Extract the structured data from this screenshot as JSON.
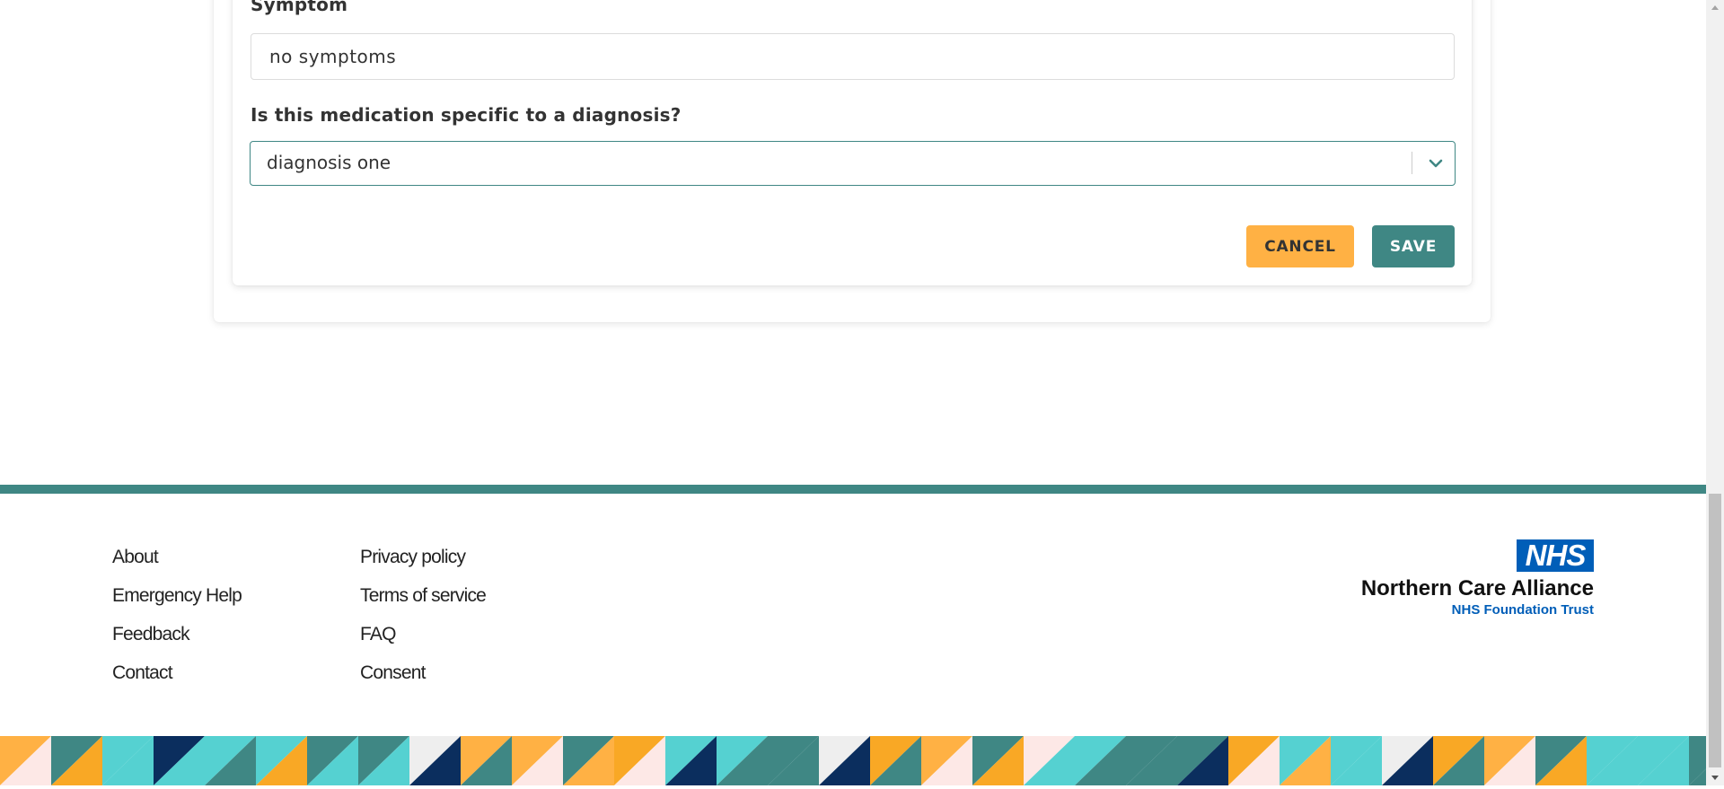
{
  "form": {
    "symptom_label": "Symptom",
    "symptom_value": "no symptoms",
    "diagnosis_question": "Is this medication specific to a diagnosis?",
    "diagnosis_value": "diagnosis one",
    "cancel_label": "CANCEL",
    "save_label": "SAVE"
  },
  "footer": {
    "col1": [
      {
        "label": "About"
      },
      {
        "label": "Emergency Help"
      },
      {
        "label": "Feedback"
      },
      {
        "label": "Contact"
      }
    ],
    "col2": [
      {
        "label": "Privacy policy"
      },
      {
        "label": "Terms of service"
      },
      {
        "label": "FAQ"
      },
      {
        "label": "Consent"
      }
    ],
    "logo": {
      "nhs": "NHS",
      "org": "Northern Care Alliance",
      "trust": "NHS Foundation Trust"
    }
  },
  "colors": {
    "primary_teal": "#3f8784",
    "accent_orange": "#ffb144",
    "nhs_blue": "#005eb8",
    "pattern": [
      "#ffb144",
      "#3f8784",
      "#55d1d1",
      "#0b2e5e",
      "#f9a825",
      "#fde8e6",
      "#eeeeee"
    ]
  },
  "icons": {
    "select_chevron": "chevron-down-icon",
    "scroll_up": "scroll-up-arrow-icon",
    "scroll_down": "scroll-down-arrow-icon"
  }
}
